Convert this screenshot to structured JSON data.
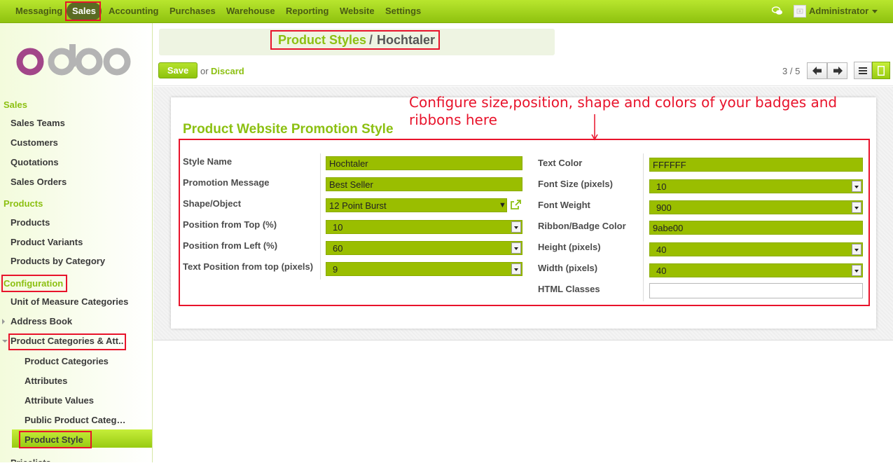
{
  "topbar": {
    "menus": [
      "Messaging",
      "Sales",
      "Accounting",
      "Purchases",
      "Warehouse",
      "Reporting",
      "Website",
      "Settings"
    ],
    "user": "Administrator"
  },
  "logo": "odoo",
  "sidebar": {
    "sales_header": "Sales",
    "sales_items": [
      "Sales Teams",
      "Customers",
      "Quotations",
      "Sales Orders"
    ],
    "products_header": "Products",
    "products_items": [
      "Products",
      "Product Variants",
      "Products by Category"
    ],
    "config_header": "Configuration",
    "config_items": [
      "Unit of Measure Categories",
      "Address Book",
      "Product Categories & Att.."
    ],
    "config_sub_items": [
      "Product Categories",
      "Attributes",
      "Attribute Values",
      "Public Product Categ…",
      "Product Style"
    ],
    "cutoff_item": "Pricelists"
  },
  "breadcrumb": {
    "parent": "Product Styles",
    "separator": "/",
    "current": "Hochtaler"
  },
  "toolbar": {
    "save_label": "Save",
    "or_text": "or",
    "discard_label": "Discard",
    "pager": "3 / 5"
  },
  "annotation": "Configure size,position, shape and colors of your badges and ribbons here",
  "form": {
    "title": "Product Website Promotion Style",
    "left": [
      {
        "label": "Style Name",
        "value": "Hochtaler"
      },
      {
        "label": "Promotion Message",
        "value": "Best Seller"
      },
      {
        "label": "Shape/Object",
        "value": "12 Point Burst"
      },
      {
        "label": "Position from Top (%)",
        "value": "10"
      },
      {
        "label": "Position from Left (%)",
        "value": "60"
      },
      {
        "label": "Text Position from top (pixels)",
        "value": "9"
      }
    ],
    "right": [
      {
        "label": "Text Color",
        "value": "FFFFFF"
      },
      {
        "label": "Font Size (pixels)",
        "value": "10"
      },
      {
        "label": "Font Weight",
        "value": "900"
      },
      {
        "label": "Ribbon/Badge Color",
        "value": "9abe00"
      },
      {
        "label": "Height (pixels)",
        "value": "40"
      },
      {
        "label": "Width (pixels)",
        "value": "40"
      },
      {
        "label": "HTML Classes",
        "value": ""
      }
    ]
  },
  "colors": {
    "brand_green": "#8cc012",
    "field_green": "#9abe00",
    "annotation_red": "#e8132b"
  }
}
